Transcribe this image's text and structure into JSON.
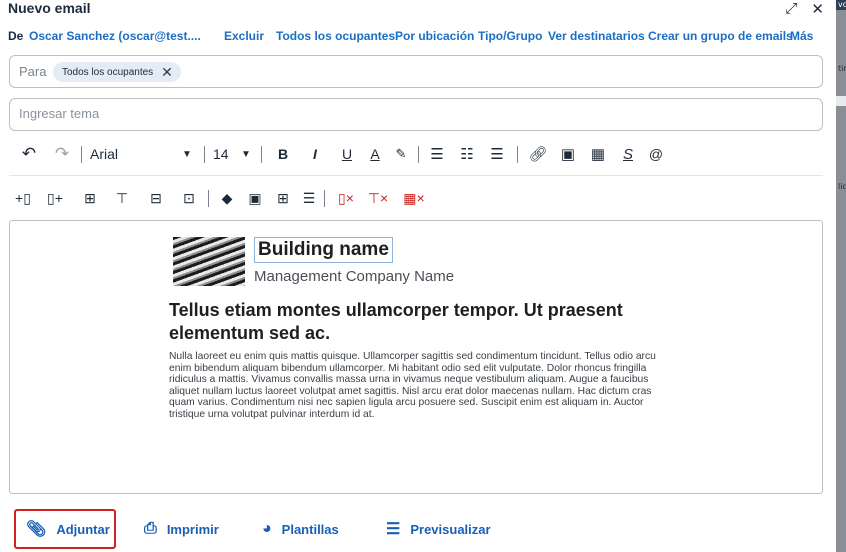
{
  "window": {
    "title": "Nuevo email",
    "expand_icon": "expand-icon",
    "close_icon": "close-icon"
  },
  "from_row": {
    "label": "De",
    "sender": "Oscar Sanchez (oscar@test....",
    "links": [
      "Excluir",
      "Todos los ocupantes",
      "Por ubicación",
      "Tipo/Grupo",
      "Ver destinatarios",
      "Crear un grupo de emails",
      "Más"
    ]
  },
  "to_field": {
    "label": "Para",
    "chip": "Todos los ocupantes"
  },
  "subject": {
    "placeholder": "Ingresar tema",
    "value": ""
  },
  "toolbar": {
    "font": "Arial",
    "size": "14",
    "bold": "B",
    "italic": "I",
    "underline": "U",
    "font_color": "A",
    "mention": "@"
  },
  "editor": {
    "building_name": "Building name",
    "company": "Management Company Name",
    "headline": "Tellus etiam montes ullamcorper tempor. Ut praesent elementum sed ac.",
    "body": "Nulla laoreet eu enim quis mattis quisque. Ullamcorper sagittis sed condimentum tincidunt. Tellus odio arcu enim bibendum aliquam bibendum ullamcorper. Mi habitant odio sed elit vulputate. Dolor rhoncus fringilla ridiculus a mattis. Vivamus convallis massa urna in vivamus neque vestibulum aliquam. Augue a faucibus aliquet nullam luctus laoreet volutpat amet sagittis. Nisl arcu erat dolor maecenas nullam. Hac dictum cras quam varius. Condimentum nisi nec sapien ligula arcu posuere sed. Suscipit enim est aliquam in. Auctor tristique urna volutpat pulvinar interdum id at."
  },
  "footer": {
    "attach": "Adjuntar",
    "print": "Imprimir",
    "templates": "Plantillas",
    "preview": "Previsualizar"
  },
  "background_strip": {
    "text_top": "vo",
    "text_mid": "tin",
    "text_low": "lic"
  },
  "colors": {
    "link_blue": "#1a6fc4",
    "footer_blue": "#1a5fb4",
    "danger_red": "#cc1f1f",
    "highlight_outline": "#cc2222"
  }
}
